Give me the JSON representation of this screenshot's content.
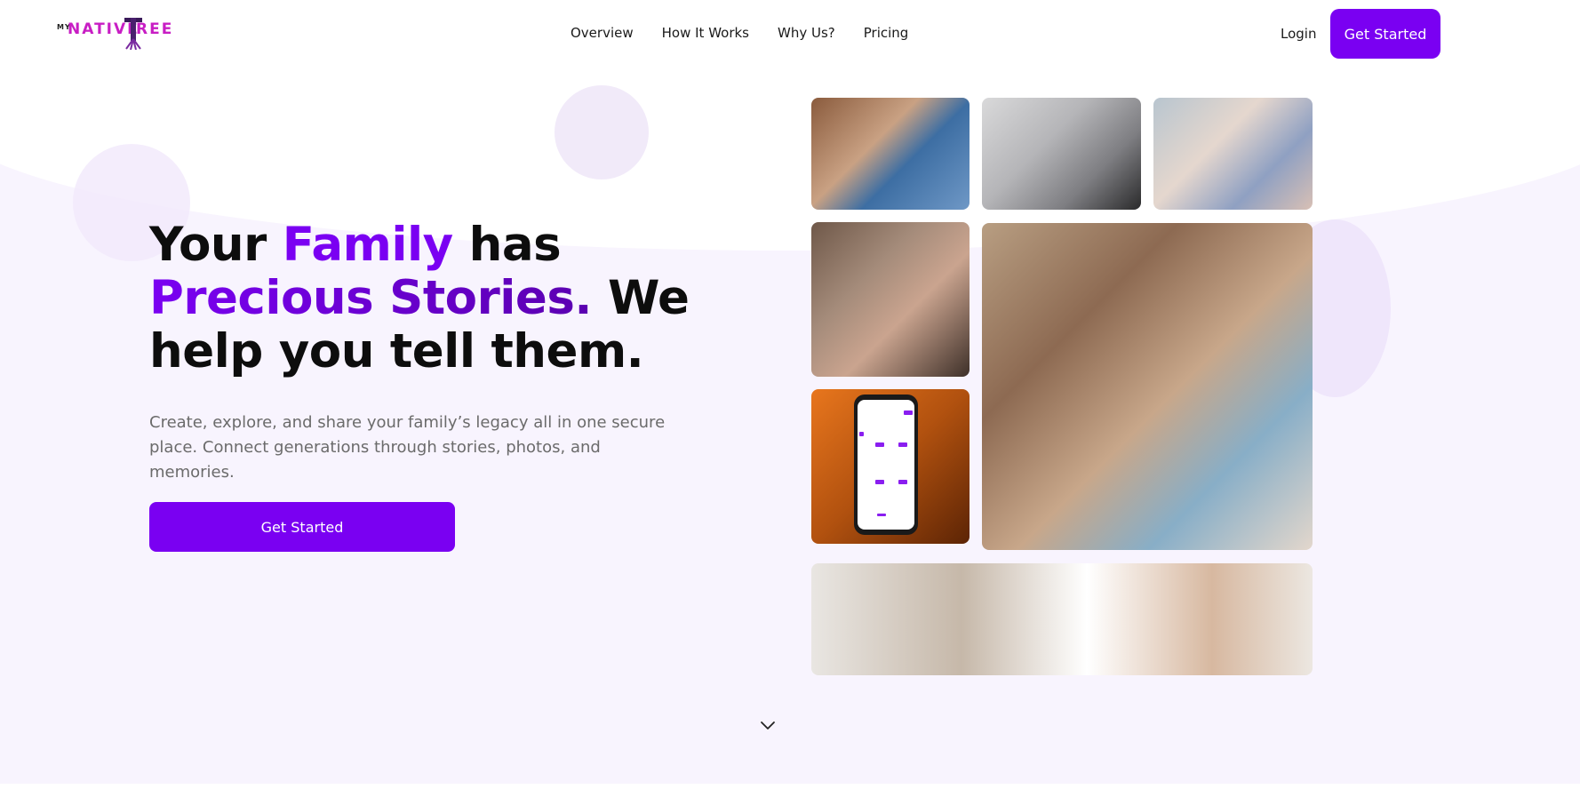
{
  "header": {
    "logo": {
      "prefix": "MY",
      "word_left": "NATIVE",
      "word_right": "REE"
    },
    "nav": [
      "Overview",
      "How It Works",
      "Why Us?",
      "Pricing"
    ],
    "login": "Login",
    "cta": "Get Started"
  },
  "hero": {
    "headline": {
      "part1": "Your ",
      "part2": "Family",
      "part3": " has ",
      "part4": "Precious Stories.",
      "part5": " We help you tell them."
    },
    "subtitle": "Create, explore, and share your family’s legacy all in one secure place. Connect generations through stories, photos, and memories.",
    "cta": "Get Started"
  },
  "colors": {
    "accent": "#7a00f2",
    "logo": "#c81ec4",
    "hero_bg": "#f8f4fe"
  },
  "icons": {
    "scroll": "chevron-down-icon"
  }
}
